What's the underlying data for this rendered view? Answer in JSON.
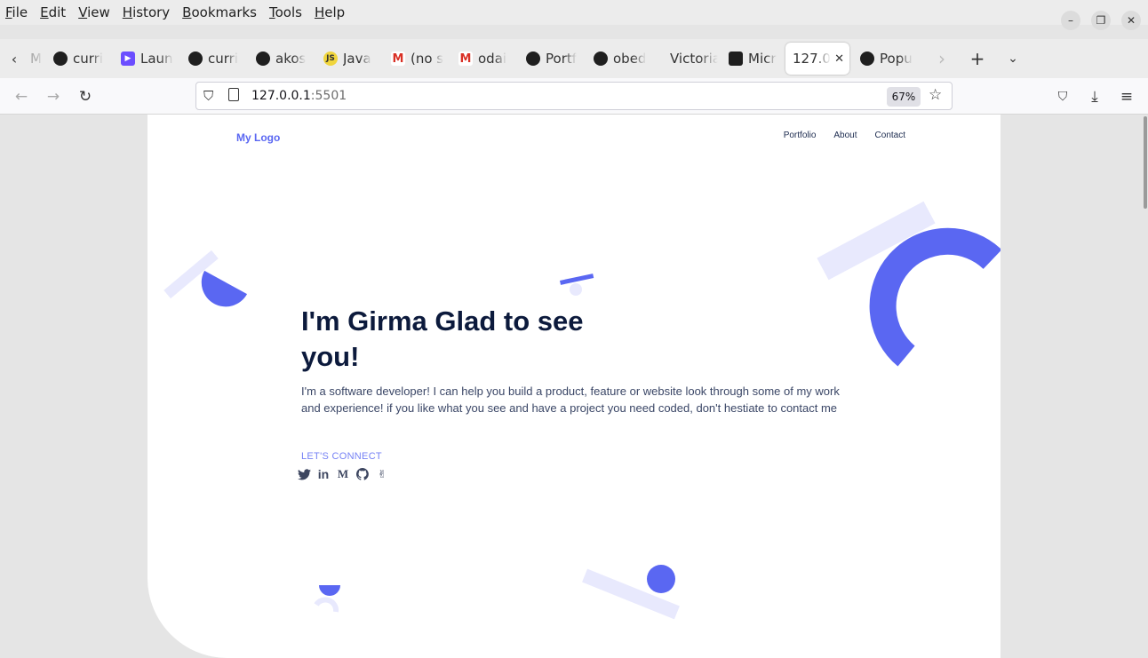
{
  "menubar": {
    "items": [
      {
        "label": "File"
      },
      {
        "label": "Edit"
      },
      {
        "label": "View"
      },
      {
        "label": "History"
      },
      {
        "label": "Bookmarks"
      },
      {
        "label": "Tools"
      },
      {
        "label": "Help"
      }
    ]
  },
  "tabs": [
    {
      "label": "M",
      "icon": "partial-tab"
    },
    {
      "label": "curri",
      "icon": "github-icon"
    },
    {
      "label": "Laun",
      "icon": "zoom-icon"
    },
    {
      "label": "curri",
      "icon": "github-icon"
    },
    {
      "label": "akos",
      "icon": "github-icon"
    },
    {
      "label": "Java",
      "icon": "js-icon"
    },
    {
      "label": "(no s",
      "icon": "gmail-icon"
    },
    {
      "label": "odai",
      "icon": "gmail-icon"
    },
    {
      "label": "Portf",
      "icon": "github-icon"
    },
    {
      "label": "obed",
      "icon": "github-icon"
    },
    {
      "label": "Victoria",
      "icon": "none"
    },
    {
      "label": "Micr",
      "icon": "figma-icon"
    },
    {
      "label": "127.0.",
      "icon": "none",
      "active": true
    },
    {
      "label": "Popu",
      "icon": "github-icon"
    }
  ],
  "navbar": {
    "url_host": "127.0.0.1",
    "url_port": ":5501",
    "zoom": "67%"
  },
  "site": {
    "logo": "My Logo",
    "nav": [
      "Portfolio",
      "About",
      "Contact"
    ],
    "hero_title": "I'm Girma Glad to see you!",
    "hero_text": "I'm a software developer! I can help you build a product, feature or website look through some of my work and experience! if you like what you see and have a project you need coded, don't hestiate to contact me",
    "connect_label": "LET'S CONNECT",
    "social_icons": [
      "twitter-icon",
      "linkedin-icon",
      "medium-icon",
      "github-icon",
      "angellist-icon"
    ]
  },
  "colors": {
    "accent": "#5a67f2",
    "accent_light": "#e8e9fd",
    "heading": "#0c1a3c"
  }
}
